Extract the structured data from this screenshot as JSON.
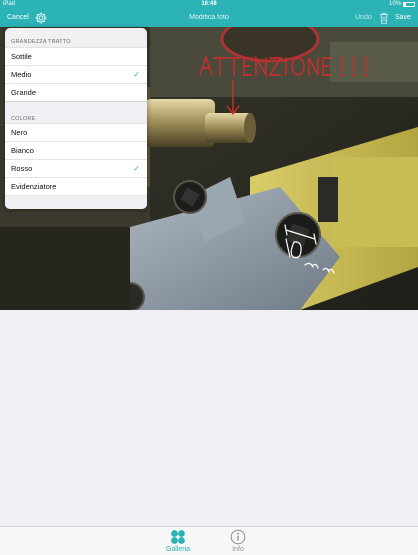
{
  "status_bar": {
    "carrier": "iPad",
    "time": "16:48",
    "battery": "10%"
  },
  "nav_bar": {
    "cancel_label": "Cancel",
    "title": "Modifica foto",
    "undo_label": "Undo",
    "save_label": "Save"
  },
  "photo": {
    "annotation_text": "ATTENZIONE !!!",
    "handwritten_dimension": "10 mm",
    "annotation_color": "#d42a2a"
  },
  "popover": {
    "stroke_header": "GRANDEZZA TRATTO",
    "stroke_options": [
      {
        "label": "Sottile",
        "checked": false
      },
      {
        "label": "Medio",
        "checked": true
      },
      {
        "label": "Grande",
        "checked": false
      }
    ],
    "color_header": "COLORE",
    "color_options": [
      {
        "label": "Nero",
        "checked": false
      },
      {
        "label": "Bianco",
        "checked": false
      },
      {
        "label": "Rosso",
        "checked": true
      },
      {
        "label": "Evidenziatore",
        "checked": false
      }
    ],
    "check_glyph": "✓"
  },
  "tab_bar": {
    "gallery_label": "Galleria",
    "info_label": "Info"
  },
  "colors": {
    "accent": "#2bb3b6",
    "nav_background": "#2bb3b6"
  }
}
